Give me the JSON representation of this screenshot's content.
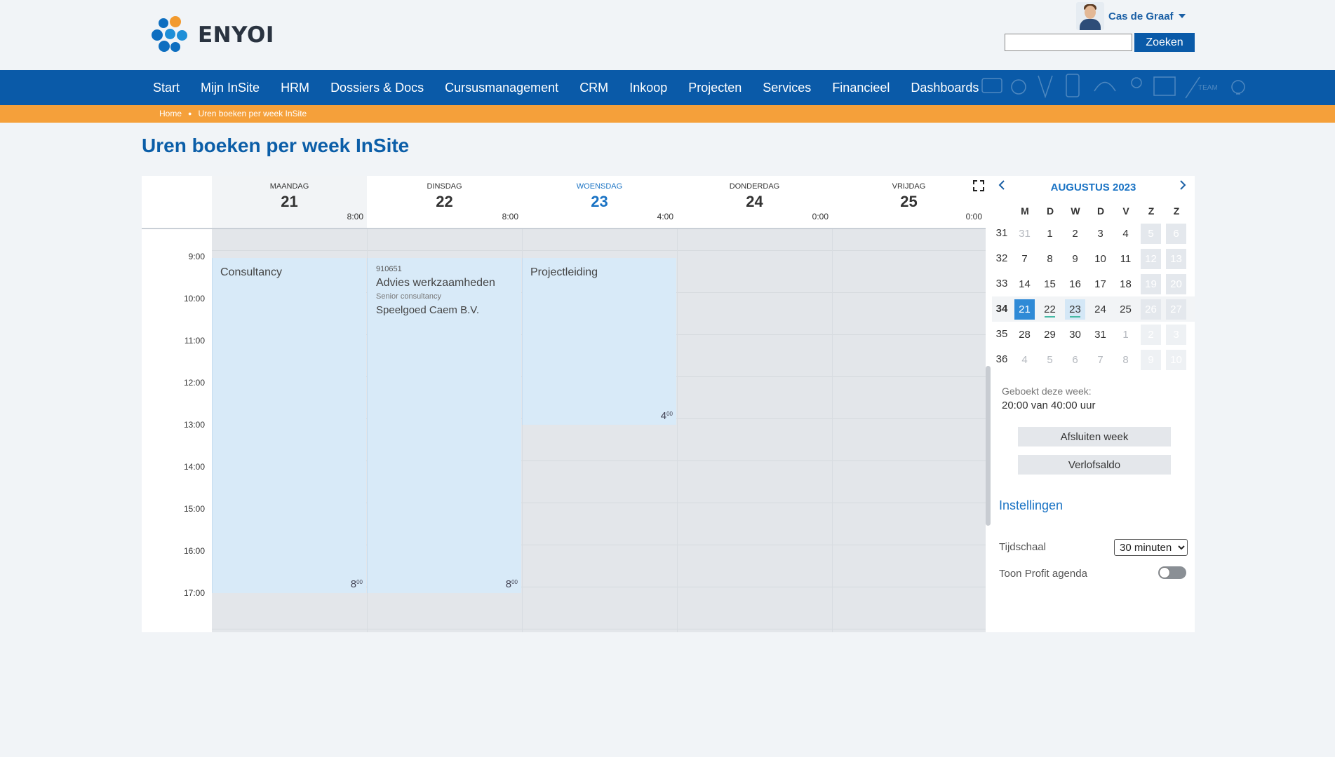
{
  "header": {
    "logo_text": "ENYOI",
    "user_name": "Cas de Graaf",
    "search_placeholder": "",
    "search_button": "Zoeken"
  },
  "nav": {
    "items": [
      "Start",
      "Mijn InSite",
      "HRM",
      "Dossiers & Docs",
      "Cursusmanagement",
      "CRM",
      "Inkoop",
      "Projecten",
      "Services",
      "Financieel",
      "Dashboards"
    ]
  },
  "breadcrumb": [
    "Home",
    "Uren boeken per week InSite"
  ],
  "page_title": "Uren boeken per week InSite",
  "week": {
    "days": [
      {
        "name": "MAANDAG",
        "date": "21",
        "hours": "8:00"
      },
      {
        "name": "DINSDAG",
        "date": "22",
        "hours": "8:00"
      },
      {
        "name": "WOENSDAG",
        "date": "23",
        "hours": "4:00"
      },
      {
        "name": "DONDERDAG",
        "date": "24",
        "hours": "0:00"
      },
      {
        "name": "VRIJDAG",
        "date": "25",
        "hours": "0:00"
      }
    ],
    "times": [
      "9:00",
      "10:00",
      "11:00",
      "12:00",
      "13:00",
      "14:00",
      "15:00",
      "16:00",
      "17:00"
    ],
    "events": [
      {
        "title": "Consultancy",
        "duration_main": "8",
        "duration_sup": "00"
      },
      {
        "code": "910651",
        "name": "Advies werkzaamheden",
        "role": "Senior consultancy",
        "client": "Speelgoed Caem B.V.",
        "duration_main": "8",
        "duration_sup": "00"
      },
      {
        "title": "Projectleiding",
        "duration_main": "4",
        "duration_sup": "00"
      }
    ]
  },
  "mini_calendar": {
    "prev_icon": "chevron-left-icon",
    "next_icon": "chevron-right-icon",
    "month_title": "AUGUSTUS 2023",
    "weekdays": [
      "M",
      "D",
      "W",
      "D",
      "V",
      "Z",
      "Z"
    ],
    "weeks": [
      {
        "week": "31",
        "days": [
          "31",
          "1",
          "2",
          "3",
          "4",
          "5",
          "6"
        ]
      },
      {
        "week": "32",
        "days": [
          "7",
          "8",
          "9",
          "10",
          "11",
          "12",
          "13"
        ]
      },
      {
        "week": "33",
        "days": [
          "14",
          "15",
          "16",
          "17",
          "18",
          "19",
          "20"
        ]
      },
      {
        "week": "34",
        "days": [
          "21",
          "22",
          "23",
          "24",
          "25",
          "26",
          "27"
        ]
      },
      {
        "week": "35",
        "days": [
          "28",
          "29",
          "30",
          "31",
          "1",
          "2",
          "3"
        ]
      },
      {
        "week": "36",
        "days": [
          "4",
          "5",
          "6",
          "7",
          "8",
          "9",
          "10"
        ]
      }
    ]
  },
  "summary": {
    "label": "Geboekt deze week:",
    "value": "20:00 van 40:00 uur"
  },
  "buttons": {
    "close_week": "Afsluiten week",
    "leave_balance": "Verlofsaldo"
  },
  "settings": {
    "title": "Instellingen",
    "timescale_label": "Tijdschaal",
    "timescale_value": "30 minuten",
    "profit_label": "Toon Profit agenda"
  },
  "colors": {
    "primary": "#0a5aa8",
    "accent": "#f5a03a",
    "today": "#1a73c4",
    "event_bg": "#d8eaf8"
  }
}
